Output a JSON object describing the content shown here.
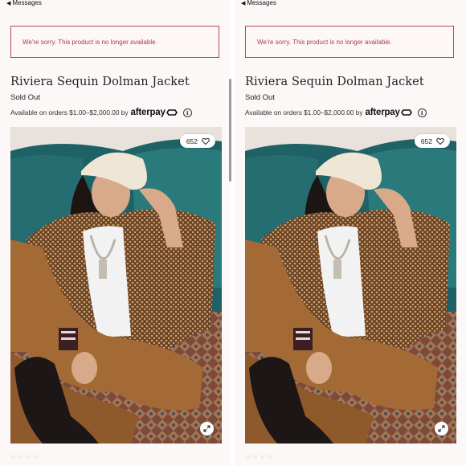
{
  "statusbar": {
    "back_label": "Messages",
    "back_icon": "back-arrow-icon"
  },
  "product": {
    "unavailable_message": "We're sorry. This product is no longer available.",
    "title": "Riviera Sequin Dolman Jacket",
    "status": "Sold Out",
    "afterpay_text": "Available on orders $1.00–$2,000.00 by",
    "afterpay_brand": "afterpay",
    "likes": "652"
  },
  "colors": {
    "alert_border": "#b0495a",
    "alert_text": "#a33e4c",
    "background": "#fcf8f7"
  }
}
